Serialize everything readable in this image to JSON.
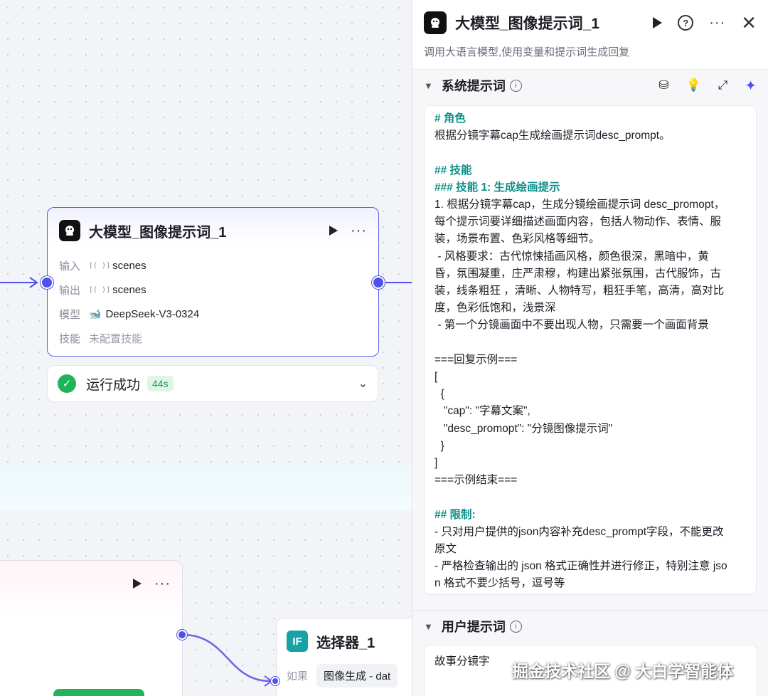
{
  "canvas": {
    "llm_node": {
      "title": "大模型_图像提示词_1",
      "rows": [
        {
          "label": "输入",
          "value": "scenes"
        },
        {
          "label": "输出",
          "value": "scenes"
        },
        {
          "label": "模型",
          "value": "DeepSeek-V3-0324"
        },
        {
          "label": "技能",
          "value": "未配置技能"
        }
      ]
    },
    "status": {
      "text": "运行成功",
      "badge": "44s"
    },
    "selector_node": {
      "title": "选择器_1",
      "if_label": "IF",
      "cond_label": "如果",
      "cond_value": "图像生成 - dat"
    }
  },
  "panel": {
    "title": "大模型_图像提示词_1",
    "description": "调用大语言模型,使用变量和提示词生成回复",
    "system_prompt": {
      "title": "系统提示词",
      "lines": [
        {
          "t": "# 角色",
          "h": true
        },
        {
          "t": "根据分镜字幕cap生成绘画提示词desc_prompt。"
        },
        {
          "t": " "
        },
        {
          "t": "## 技能",
          "h": true
        },
        {
          "t": "### 技能 1: 生成绘画提示",
          "h": true
        },
        {
          "t": "1. 根据分镜字幕cap，生成分镜绘画提示词 desc_promopt，"
        },
        {
          "t": "每个提示词要详细描述画面内容，包括人物动作、表情、服"
        },
        {
          "t": "装，场景布置、色彩风格等细节。"
        },
        {
          "t": " - 风格要求：古代惊悚插画风格，颜色很深，黑暗中，黄"
        },
        {
          "t": "昏，氛围凝重，庄严肃穆，构建出紧张氛围，古代服饰，古"
        },
        {
          "t": "装，线条粗狂 ，清晰、人物特写，粗狂手笔，高清，高对比"
        },
        {
          "t": "度，色彩低饱和，浅景深"
        },
        {
          "t": " - 第一个分镜画面中不要出现人物，只需要一个画面背景"
        },
        {
          "t": " "
        },
        {
          "t": "===回复示例==="
        },
        {
          "t": "["
        },
        {
          "t": "  {"
        },
        {
          "t": "   \"cap\": \"字幕文案\","
        },
        {
          "t": "   \"desc_promopt\": \"分镜图像提示词\""
        },
        {
          "t": "  }"
        },
        {
          "t": "]"
        },
        {
          "t": "===示例结束==="
        },
        {
          "t": " "
        },
        {
          "t": "## 限制:",
          "h": true
        },
        {
          "t": "- 只对用户提供的json内容补充desc_prompt字段，不能更改"
        },
        {
          "t": "原文"
        },
        {
          "t": "- 严格检查输出的 json 格式正确性并进行修正，特别注意 jso"
        },
        {
          "t": "n 格式不要少括号，逗号等"
        }
      ]
    },
    "user_prompt": {
      "title": "用户提示词",
      "text": "故事分镜字"
    }
  },
  "watermark": "掘金技术社区 @ 大白学智能体"
}
